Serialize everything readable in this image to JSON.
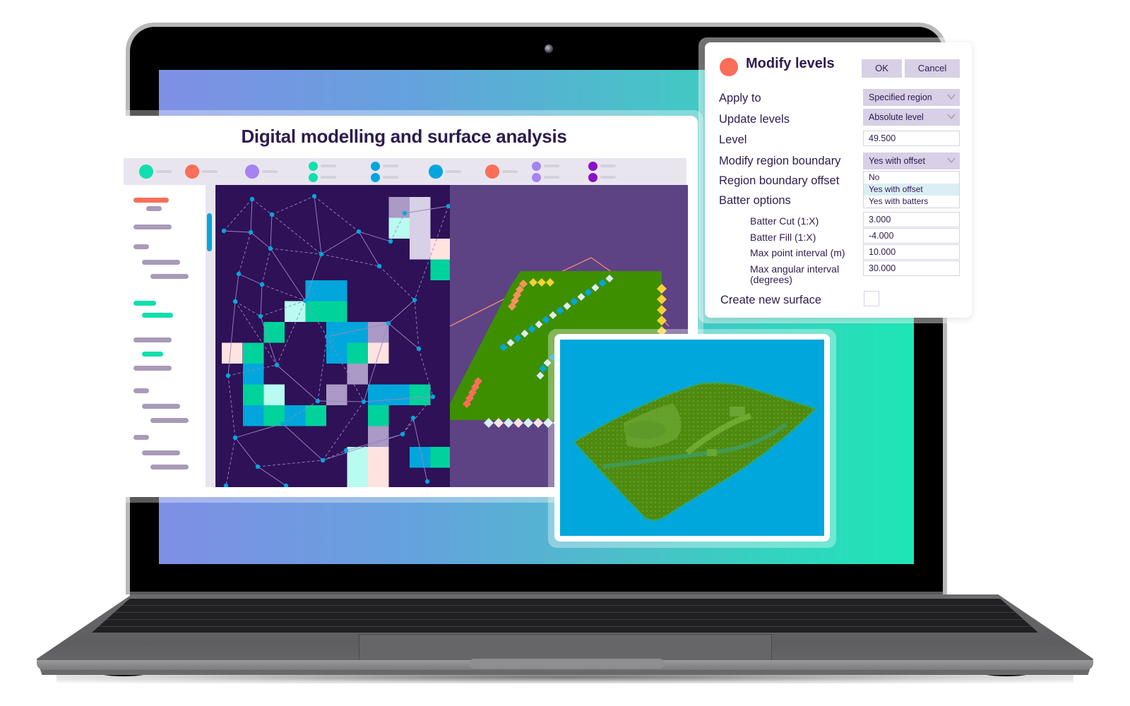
{
  "panel": {
    "title": "Digital modelling and surface analysis",
    "legend": [
      {
        "icon": "legend-dot",
        "colors": [
          "#12dfae"
        ]
      },
      {
        "icon": "legend-dot",
        "colors": [
          "#fb6e58"
        ]
      },
      {
        "icon": "legend-dot",
        "colors": [
          "#a583f1"
        ]
      },
      {
        "icon": "legend-dot-pair",
        "colors": [
          "#12dfae",
          "#12dfae"
        ]
      },
      {
        "icon": "legend-dot-pair",
        "colors": [
          "#00a6dc",
          "#00a6dc"
        ]
      },
      {
        "icon": "legend-dot",
        "colors": [
          "#00a6dc"
        ]
      },
      {
        "icon": "legend-dot",
        "colors": [
          "#fb6e58"
        ]
      },
      {
        "icon": "legend-dot-pair",
        "colors": [
          "#a583f1",
          "#a583f1"
        ]
      },
      {
        "icon": "legend-dot-pair",
        "colors": [
          "#8b12c4",
          "#8b12c4"
        ]
      }
    ],
    "sidebar_items": [
      {
        "color": "#fb6e58"
      },
      {
        "color": "#a89ab8"
      },
      {
        "color": "#a89ab8"
      },
      {
        "color": "#a89ab8"
      },
      {
        "color": "#a89ab8"
      },
      {
        "color": "#a89ab8"
      },
      {
        "color": "#12dfae"
      },
      {
        "color": "#12dfae"
      },
      {
        "color": "#a89ab8"
      },
      {
        "color": "#12dfae"
      },
      {
        "color": "#a89ab8"
      },
      {
        "color": "#a89ab8"
      },
      {
        "color": "#a89ab8"
      },
      {
        "color": "#a89ab8"
      },
      {
        "color": "#a89ab8"
      },
      {
        "color": "#a89ab8"
      },
      {
        "color": "#a89ab8"
      }
    ]
  },
  "dialog": {
    "title": "Modify levels",
    "ok_label": "OK",
    "cancel_label": "Cancel",
    "fields": {
      "apply_to": {
        "label": "Apply to",
        "value": "Specified region"
      },
      "update_levels": {
        "label": "Update levels",
        "value": "Absolute level"
      },
      "level": {
        "label": "Level",
        "value": "49.500"
      },
      "modify_region_boundary": {
        "label": "Modify region boundary",
        "value": "Yes with offset",
        "options": [
          "No",
          "Yes with offset",
          "Yes with batters"
        ],
        "highlighted": "Yes with offset"
      },
      "region_boundary_offset": {
        "label": "Region boundary offset"
      },
      "batter_options": {
        "label": "Batter options"
      },
      "batter_cut": {
        "label": "Batter Cut (1:X)",
        "value": "3.000"
      },
      "batter_fill": {
        "label": "Batter Fill (1:X)",
        "value": "-4.000"
      },
      "max_point_interval": {
        "label": "Max point interval (m)",
        "value": "10.000"
      },
      "max_angular_interval": {
        "label_line1": "Max angular interval",
        "label_line2": "(degrees)",
        "value": "30.000"
      },
      "create_new_surface": {
        "label": "Create new surface",
        "checked": false
      }
    }
  },
  "colors": {
    "accent_orange": "#fb6e58",
    "dark_purple": "#2d1b4e",
    "mesh_bg": "#2e1157",
    "surface_bg": "#5d4284",
    "surface_green": "#3e8f00",
    "viewer_bg": "#00a7dc",
    "control_lilac": "#d8d0e6"
  }
}
